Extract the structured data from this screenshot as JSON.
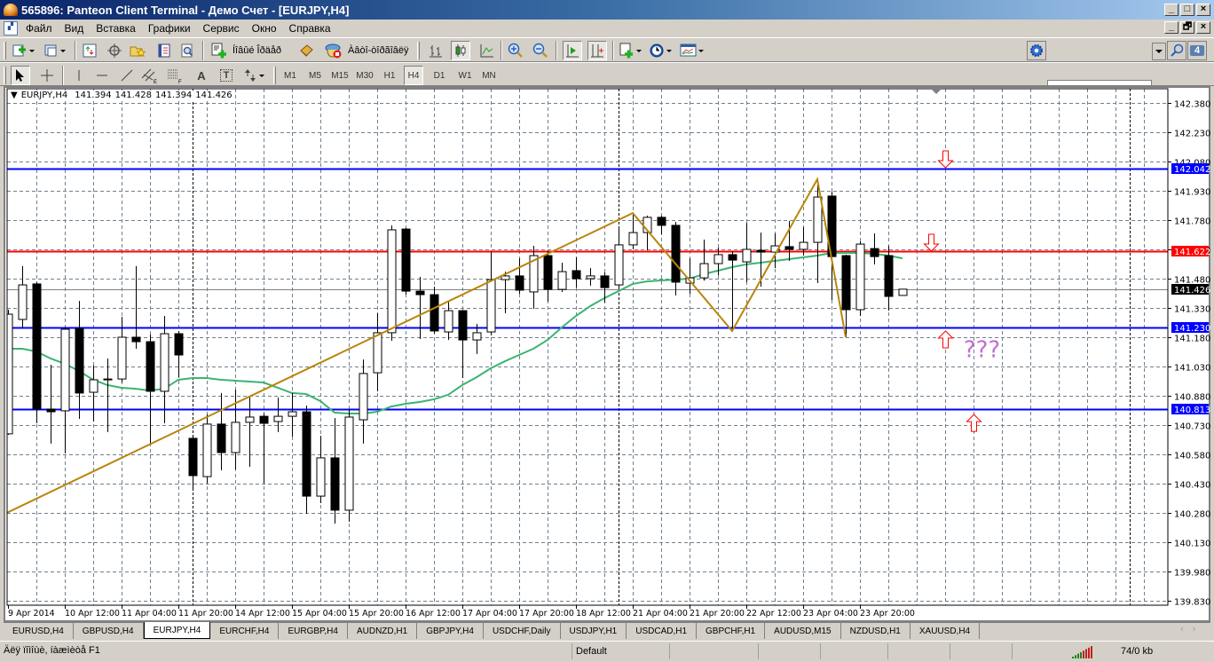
{
  "window": {
    "title": "565896: Panteon Client Terminal - Демо Счет - [EURJPY,H4]",
    "minimize": "_",
    "maximize": "□",
    "close": "×",
    "restore": "🗗"
  },
  "menu": [
    "Файл",
    "Вид",
    "Вставка",
    "Графики",
    "Сервис",
    "Окно",
    "Справка"
  ],
  "toolbar": {
    "new_order": "Íîâûé Îðäåð",
    "autotrading": "Àâòî-òîðãîâëÿ",
    "search_value": "",
    "notifications_count": "4",
    "timeframes": [
      "M1",
      "M5",
      "M15",
      "M30",
      "H1",
      "H4",
      "D1",
      "W1",
      "MN"
    ],
    "active_timeframe": "H4",
    "draw_text_tool": "A",
    "draw_label_tool": "T"
  },
  "chart": {
    "symbol_label": "EURJPY,H4",
    "ohlc": [
      "141.394",
      "141.428",
      "141.394",
      "141.426"
    ]
  },
  "chart_data": {
    "type": "candlestick",
    "symbol": "EURJPY",
    "timeframe": "H4",
    "ylim": [
      139.83,
      142.38
    ],
    "grid": true,
    "price_ticks": [
      "142.380",
      "142.230",
      "142.080",
      "141.930",
      "141.780",
      "141.630",
      "141.480",
      "141.330",
      "141.180",
      "141.030",
      "140.880",
      "140.730",
      "140.580",
      "140.430",
      "140.280",
      "140.130",
      "139.980",
      "139.830"
    ],
    "time_labels": [
      "9 Apr 2014",
      "10 Apr 12:00",
      "11 Apr 04:00",
      "11 Apr 20:00",
      "14 Apr 12:00",
      "15 Apr 04:00",
      "15 Apr 20:00",
      "16 Apr 12:00",
      "17 Apr 04:00",
      "17 Apr 20:00",
      "18 Apr 12:00",
      "21 Apr 04:00",
      "21 Apr 20:00",
      "22 Apr 12:00",
      "23 Apr 04:00",
      "23 Apr 20:00"
    ],
    "time_label_every_bars": 4,
    "candles_ohlc": [
      [
        140.685,
        141.321,
        140.68,
        141.298
      ],
      [
        141.271,
        141.544,
        141.225,
        141.448
      ],
      [
        141.453,
        141.462,
        140.739,
        140.812
      ],
      [
        140.812,
        141.039,
        140.635,
        140.798
      ],
      [
        140.803,
        141.23,
        140.585,
        141.221
      ],
      [
        141.225,
        141.366,
        140.762,
        140.894
      ],
      [
        140.898,
        141.035,
        140.748,
        140.962
      ],
      [
        140.962,
        141.071,
        140.694,
        140.966
      ],
      [
        140.966,
        141.284,
        140.948,
        141.18
      ],
      [
        141.18,
        141.544,
        141.121,
        141.157
      ],
      [
        141.157,
        141.194,
        140.635,
        140.903
      ],
      [
        140.903,
        141.289,
        140.739,
        141.198
      ],
      [
        141.198,
        141.212,
        140.975,
        141.089
      ],
      [
        140.662,
        140.68,
        140.398,
        140.471
      ],
      [
        140.466,
        140.785,
        140.43,
        140.735
      ],
      [
        140.735,
        140.894,
        140.498,
        140.589
      ],
      [
        140.589,
        140.912,
        140.503,
        140.744
      ],
      [
        140.744,
        140.875,
        140.516,
        140.771
      ],
      [
        140.775,
        140.79,
        140.43,
        140.739
      ],
      [
        140.748,
        140.871,
        140.694,
        140.775
      ],
      [
        140.775,
        140.894,
        140.671,
        140.798
      ],
      [
        140.798,
        140.83,
        140.276,
        140.366
      ],
      [
        140.366,
        140.675,
        140.33,
        140.562
      ],
      [
        140.562,
        140.766,
        140.225,
        140.294
      ],
      [
        140.294,
        140.812,
        140.235,
        140.771
      ],
      [
        140.757,
        141.066,
        140.635,
        140.994
      ],
      [
        140.998,
        141.303,
        140.903,
        141.203
      ],
      [
        141.203,
        141.753,
        141.162,
        141.73
      ],
      [
        141.734,
        141.74,
        141.398,
        141.416
      ],
      [
        141.416,
        141.489,
        141.171,
        141.398
      ],
      [
        141.398,
        141.439,
        141.198,
        141.212
      ],
      [
        141.207,
        141.362,
        141.166,
        141.316
      ],
      [
        141.316,
        141.32,
        140.971,
        141.166
      ],
      [
        141.166,
        141.248,
        141.094,
        141.203
      ],
      [
        141.207,
        141.616,
        141.189,
        141.475
      ],
      [
        141.475,
        141.516,
        141.303,
        141.494
      ],
      [
        141.494,
        141.584,
        141.403,
        141.421
      ],
      [
        141.412,
        141.648,
        141.325,
        141.598
      ],
      [
        141.598,
        141.621,
        141.362,
        141.425
      ],
      [
        141.425,
        141.562,
        141.412,
        141.516
      ],
      [
        141.521,
        141.589,
        141.434,
        141.48
      ],
      [
        141.48,
        141.534,
        141.444,
        141.494
      ],
      [
        141.494,
        141.512,
        141.357,
        141.434
      ],
      [
        141.448,
        141.744,
        141.43,
        141.653
      ],
      [
        141.653,
        141.807,
        141.63,
        141.716
      ],
      [
        141.716,
        141.803,
        141.625,
        141.794
      ],
      [
        141.794,
        141.803,
        141.707,
        141.753
      ],
      [
        141.753,
        141.771,
        141.394,
        141.462
      ],
      [
        141.457,
        141.584,
        141.403,
        141.484
      ],
      [
        141.484,
        141.68,
        141.47,
        141.557
      ],
      [
        141.557,
        141.639,
        141.498,
        141.603
      ],
      [
        141.603,
        141.621,
        141.212,
        141.575
      ],
      [
        141.566,
        141.766,
        141.462,
        141.63
      ],
      [
        141.625,
        141.716,
        141.439,
        141.616
      ],
      [
        141.616,
        141.712,
        141.534,
        141.648
      ],
      [
        141.644,
        141.775,
        141.571,
        141.63
      ],
      [
        141.63,
        141.744,
        141.598,
        141.666
      ],
      [
        141.666,
        141.989,
        141.457,
        141.898
      ],
      [
        141.903,
        141.925,
        141.371,
        141.593
      ],
      [
        141.598,
        141.603,
        141.18,
        141.321
      ],
      [
        141.321,
        141.671,
        141.289,
        141.657
      ],
      [
        141.634,
        141.712,
        141.553,
        141.593
      ],
      [
        141.598,
        141.648,
        141.316,
        141.389
      ],
      [
        141.394,
        141.428,
        141.394,
        141.426
      ]
    ],
    "moving_average": [
      141.121,
      141.121,
      141.107,
      141.071,
      141.044,
      141.007,
      140.962,
      140.935,
      140.921,
      140.916,
      140.907,
      140.916,
      140.962,
      140.971,
      140.971,
      140.962,
      140.957,
      140.953,
      140.948,
      140.921,
      140.894,
      140.889,
      140.853,
      140.794,
      140.789,
      140.789,
      140.798,
      140.825,
      140.839,
      140.848,
      140.862,
      140.885,
      140.935,
      140.975,
      141.021,
      141.057,
      141.089,
      141.121,
      141.166,
      141.23,
      141.289,
      141.339,
      141.38,
      141.416,
      141.453,
      141.466,
      141.471,
      141.475,
      141.48,
      141.503,
      141.521,
      141.539,
      141.553,
      141.562,
      141.571,
      141.58,
      141.589,
      141.598,
      141.612,
      141.612,
      141.612,
      141.607,
      141.598,
      141.584
    ],
    "ma_color": "#3cb371",
    "zigzag": [
      [
        -0.1,
        140.28
      ],
      [
        44,
        141.816
      ],
      [
        51,
        141.212
      ],
      [
        57,
        141.989
      ],
      [
        59,
        141.18
      ]
    ],
    "zigzag_color": "#b8860b",
    "period_separators_bar_index": [
      13,
      43,
      79
    ],
    "horizontal_lines": [
      {
        "price": 142.042,
        "label": "142.042",
        "color": "#0000ff"
      },
      {
        "price": 141.622,
        "label": "141.622",
        "color": "#ff0000"
      },
      {
        "price": 141.23,
        "label": "141.230",
        "color": "#0000ff"
      },
      {
        "price": 140.813,
        "label": "140.813",
        "color": "#0000ff"
      }
    ],
    "bid_line": {
      "price": 141.426,
      "label": "141.426",
      "color": "#000000"
    },
    "arrows": [
      {
        "dir": "down",
        "bar": 66,
        "price": 142.048
      },
      {
        "dir": "down",
        "bar": 65,
        "price": 141.621
      },
      {
        "dir": "up",
        "bar": 66,
        "price": 141.212
      },
      {
        "dir": "up",
        "bar": 68,
        "price": 140.784
      }
    ],
    "annotation": {
      "text": "???",
      "bar": 67.3,
      "price": 141.077,
      "color": "#c070d0"
    }
  },
  "tabs": [
    "EURUSD,H4",
    "GBPUSD,H4",
    "EURJPY,H4",
    "EURCHF,H4",
    "EURGBP,H4",
    "AUDNZD,H1",
    "GBPJPY,H4",
    "USDCHF,Daily",
    "USDJPY,H1",
    "USDCAD,H1",
    "GBPCHF,H1",
    "AUDUSD,M15",
    "NZDUSD,H1",
    "XAUUSD,H4"
  ],
  "active_tab": "EURJPY,H4",
  "tab_scroll": [
    "‹",
    "›"
  ],
  "status": {
    "help": "Äëÿ ïîìîùè, íàæìèòå F1",
    "profile": "Default",
    "traffic": "74/0 kb"
  }
}
